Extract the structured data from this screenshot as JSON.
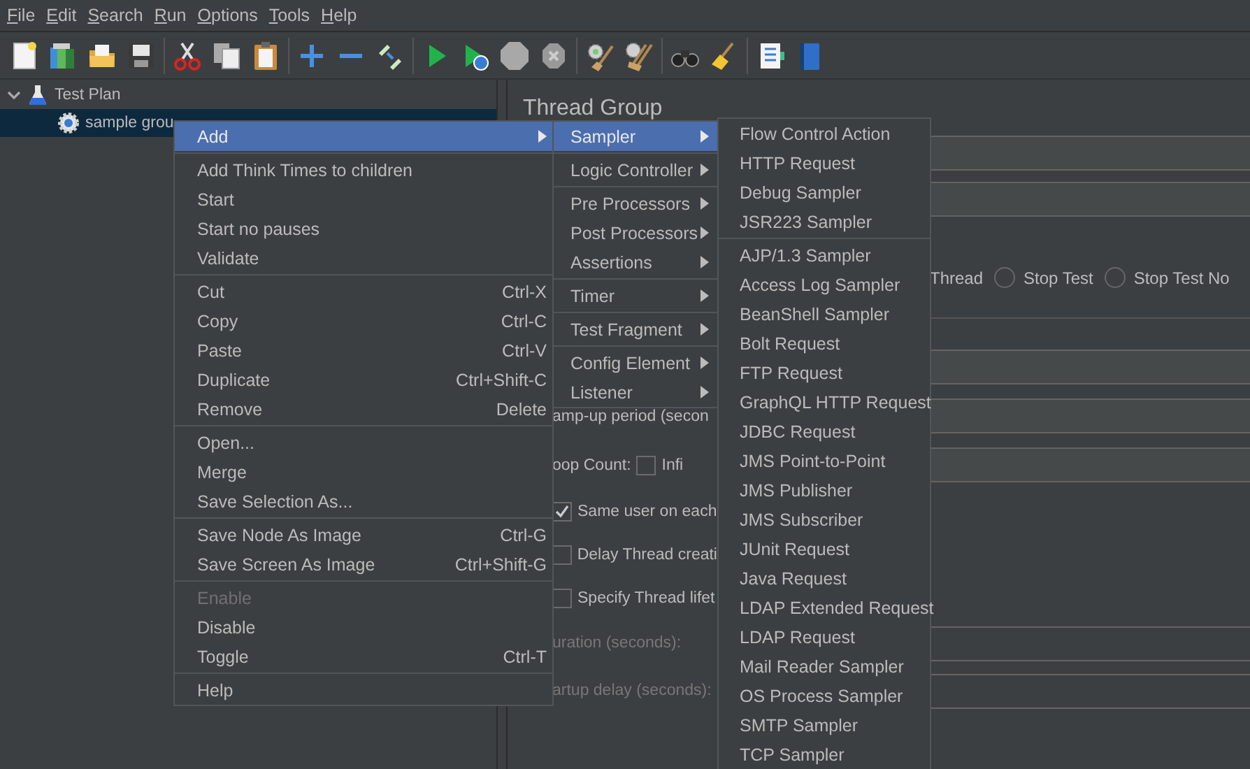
{
  "menu_bar": [
    {
      "label": "File"
    },
    {
      "label": "Edit"
    },
    {
      "label": "Search"
    },
    {
      "label": "Run"
    },
    {
      "label": "Options"
    },
    {
      "label": "Tools"
    },
    {
      "label": "Help"
    }
  ],
  "tree": [
    {
      "label": "Test Plan",
      "kind": "test_plan",
      "expanded": true,
      "selected": false,
      "children": [
        {
          "label": "sample grou",
          "kind": "thread_group",
          "selected": true
        }
      ]
    }
  ],
  "editor": {
    "title": "Thread Group",
    "rows": [
      {
        "kind": "field"
      },
      {
        "kind": "field"
      },
      {
        "kind": "radios",
        "partial_label": "Thread",
        "options": [
          {
            "label": "Stop Test",
            "selected": false
          },
          {
            "label": "Stop Test No",
            "selected": false
          }
        ]
      },
      {
        "kind": "rule"
      },
      {
        "kind": "field"
      },
      {
        "kind": "field",
        "label": "amp-up period (secon"
      },
      {
        "kind": "field",
        "label": "oop Count:",
        "checkbox": {
          "label": "Infi",
          "checked": false
        }
      },
      {
        "kind": "checkbox",
        "label": "Same user on each",
        "checked": true
      },
      {
        "kind": "checkbox",
        "label": "Delay Thread creati",
        "checked": false
      },
      {
        "kind": "checkbox",
        "label": "Specify Thread lifet",
        "checked": false
      },
      {
        "kind": "field",
        "label": "uration (seconds):",
        "disabled": true
      },
      {
        "kind": "field",
        "label": "artup delay (seconds):",
        "disabled": true
      }
    ]
  },
  "context_menu": {
    "groups": [
      [
        {
          "label": "Add",
          "submenu": true,
          "selected": true,
          "disabled": false
        }
      ],
      [
        {
          "label": "Add Think Times to children",
          "selected": false,
          "disabled": false
        },
        {
          "label": "Start",
          "selected": false,
          "disabled": false
        },
        {
          "label": "Start no pauses",
          "selected": false,
          "disabled": false
        },
        {
          "label": "Validate",
          "selected": false,
          "disabled": false
        }
      ],
      [
        {
          "label": "Cut",
          "shortcut": "Ctrl-X",
          "selected": false,
          "disabled": false
        },
        {
          "label": "Copy",
          "shortcut": "Ctrl-C",
          "selected": false,
          "disabled": false
        },
        {
          "label": "Paste",
          "shortcut": "Ctrl-V",
          "selected": false,
          "disabled": false
        },
        {
          "label": "Duplicate",
          "shortcut": "Ctrl+Shift-C",
          "selected": false,
          "disabled": false
        },
        {
          "label": "Remove",
          "shortcut": "Delete",
          "selected": false,
          "disabled": false
        }
      ],
      [
        {
          "label": "Open...",
          "selected": false,
          "disabled": false
        },
        {
          "label": "Merge",
          "selected": false,
          "disabled": false
        },
        {
          "label": "Save Selection As...",
          "selected": false,
          "disabled": false
        }
      ],
      [
        {
          "label": "Save Node As Image",
          "shortcut": "Ctrl-G",
          "selected": false,
          "disabled": false
        },
        {
          "label": "Save Screen As Image",
          "shortcut": "Ctrl+Shift-G",
          "selected": false,
          "disabled": false
        }
      ],
      [
        {
          "label": "Enable",
          "selected": false,
          "disabled": true
        },
        {
          "label": "Disable",
          "selected": false,
          "disabled": false
        },
        {
          "label": "Toggle",
          "shortcut": "Ctrl-T",
          "selected": false,
          "disabled": false
        }
      ],
      [
        {
          "label": "Help",
          "selected": false,
          "disabled": false
        }
      ]
    ]
  },
  "add_submenu": {
    "groups": [
      [
        {
          "label": "Sampler",
          "submenu": true,
          "selected": true
        }
      ],
      [
        {
          "label": "Logic Controller",
          "submenu": true,
          "selected": false
        }
      ],
      [
        {
          "label": "Pre Processors",
          "submenu": true,
          "selected": false
        },
        {
          "label": "Post Processors",
          "submenu": true,
          "selected": false
        },
        {
          "label": "Assertions",
          "submenu": true,
          "selected": false
        }
      ],
      [
        {
          "label": "Timer",
          "submenu": true,
          "selected": false
        }
      ],
      [
        {
          "label": "Test Fragment",
          "submenu": true,
          "selected": false
        }
      ],
      [
        {
          "label": "Config Element",
          "submenu": true,
          "selected": false
        },
        {
          "label": "Listener",
          "submenu": true,
          "selected": false
        }
      ]
    ]
  },
  "sampler_submenu": {
    "groups": [
      [
        {
          "label": "Flow Control Action",
          "selected": false
        },
        {
          "label": "HTTP Request",
          "selected": false
        },
        {
          "label": "Debug Sampler",
          "selected": false
        },
        {
          "label": "JSR223 Sampler",
          "selected": false
        }
      ],
      [
        {
          "label": "AJP/1.3 Sampler",
          "selected": false
        },
        {
          "label": "Access Log Sampler",
          "selected": false
        },
        {
          "label": "BeanShell Sampler",
          "selected": false
        },
        {
          "label": "Bolt Request",
          "selected": false
        },
        {
          "label": "FTP Request",
          "selected": false
        },
        {
          "label": "GraphQL HTTP Request",
          "selected": false
        },
        {
          "label": "JDBC Request",
          "selected": false
        },
        {
          "label": "JMS Point-to-Point",
          "selected": false
        },
        {
          "label": "JMS Publisher",
          "selected": false
        },
        {
          "label": "JMS Subscriber",
          "selected": false
        },
        {
          "label": "JUnit Request",
          "selected": false
        },
        {
          "label": "Java Request",
          "selected": false
        },
        {
          "label": "LDAP Extended Request",
          "selected": false
        },
        {
          "label": "LDAP Request",
          "selected": false
        },
        {
          "label": "Mail Reader Sampler",
          "selected": false
        },
        {
          "label": "OS Process Sampler",
          "selected": false
        },
        {
          "label": "SMTP Sampler",
          "selected": false
        },
        {
          "label": "TCP Sampler",
          "selected": false
        }
      ]
    ]
  }
}
